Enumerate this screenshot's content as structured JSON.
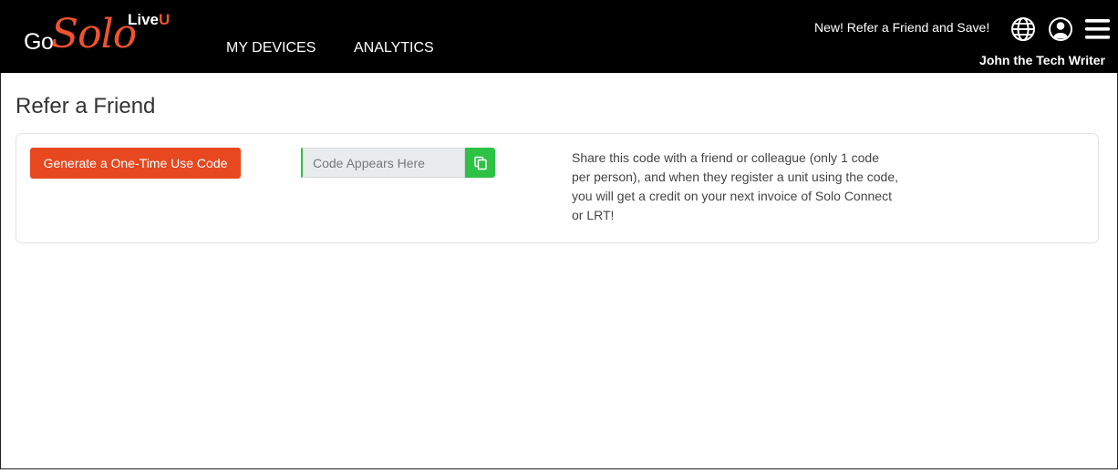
{
  "header": {
    "logo": {
      "go": "Go",
      "solo": "Solo",
      "live": "Live",
      "u": "U"
    },
    "nav": [
      {
        "label": "MY DEVICES"
      },
      {
        "label": "ANALYTICS"
      }
    ],
    "promo_link": "New! Refer a Friend and Save!",
    "icons": [
      "globe-icon",
      "user-account-icon",
      "hamburger-menu-icon"
    ],
    "username": "John the Tech Writer"
  },
  "main": {
    "title": "Refer a Friend",
    "generate_button": "Generate a One-Time Use Code",
    "code_field": {
      "value": "",
      "placeholder": "Code Appears Here"
    },
    "copy_icon": "copy-icon",
    "share_text": "Share this code with a friend or colleague (only 1 code per person), and when they register a unit using the code, you will get a credit on your next invoice of Solo Connect or LRT!"
  },
  "colors": {
    "topbar": "#000000",
    "brand_orange": "#f0532d",
    "button_orange": "#e8481f",
    "copy_green": "#2ec245"
  }
}
